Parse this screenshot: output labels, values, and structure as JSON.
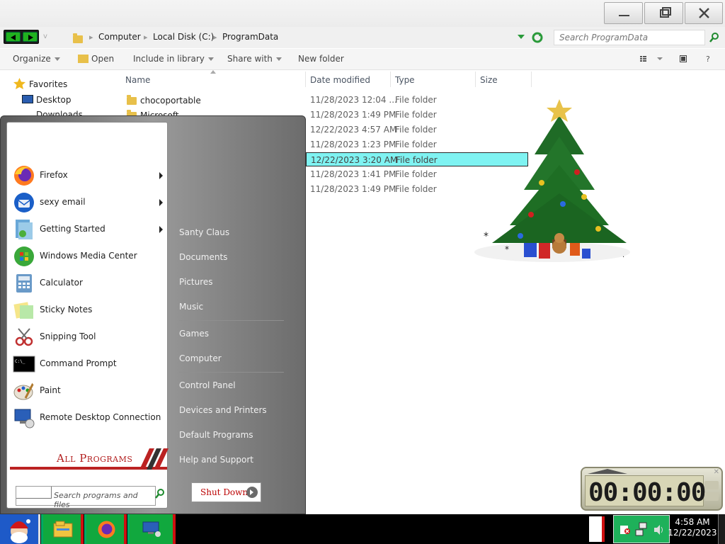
{
  "window": {
    "breadcrumb": [
      "Computer",
      "Local Disk (C:)",
      "ProgramData"
    ],
    "search_placeholder": "Search ProgramData"
  },
  "toolbar": {
    "organize": "Organize",
    "open": "Open",
    "include_in_library": "Include in library",
    "share_with": "Share with",
    "new_folder": "New folder"
  },
  "columns": {
    "name": "Name",
    "date_modified": "Date modified",
    "type": "Type",
    "size": "Size"
  },
  "nav_pane": {
    "favorites": "Favorites",
    "desktop": "Desktop",
    "downloads": "Downloads"
  },
  "files": [
    {
      "name": "chocoportable",
      "date": "11/28/2023 12:04 ...",
      "type": "File folder"
    },
    {
      "name": "Microsoft",
      "date": "11/28/2023 1:49 PM",
      "type": "File folder"
    },
    {
      "name": "",
      "date": "12/22/2023 4:57 AM",
      "type": "File folder"
    },
    {
      "name": "",
      "date": "11/28/2023 1:23 PM",
      "type": "File folder"
    },
    {
      "name": "",
      "date": "12/22/2023 3:20 AM",
      "type": "File folder",
      "selected": true
    },
    {
      "name": "",
      "date": "11/28/2023 1:41 PM",
      "type": "File folder"
    },
    {
      "name": "",
      "date": "11/28/2023 1:49 PM",
      "type": "File folder"
    }
  ],
  "start_menu": {
    "programs": [
      {
        "label": "Firefox",
        "icon": "firefox-icon",
        "submenu": true
      },
      {
        "label": "sexy email",
        "icon": "thunderbird-icon",
        "submenu": true
      },
      {
        "label": "Getting Started",
        "icon": "getting-started-icon",
        "submenu": true
      },
      {
        "label": "Windows Media Center",
        "icon": "media-center-icon",
        "submenu": false
      },
      {
        "label": "Calculator",
        "icon": "calculator-icon",
        "submenu": false
      },
      {
        "label": "Sticky Notes",
        "icon": "sticky-notes-icon",
        "submenu": false
      },
      {
        "label": "Snipping Tool",
        "icon": "snipping-tool-icon",
        "submenu": false
      },
      {
        "label": "Command Prompt",
        "icon": "command-prompt-icon",
        "submenu": false
      },
      {
        "label": "Paint",
        "icon": "paint-icon",
        "submenu": false
      },
      {
        "label": "Remote Desktop Connection",
        "icon": "remote-desktop-icon",
        "submenu": false
      }
    ],
    "all_programs": "All Programs",
    "search_placeholder": "Search programs and files",
    "places": [
      "Santy Claus",
      "Documents",
      "Pictures",
      "Music",
      "Games",
      "Computer",
      "Control Panel",
      "Devices and Printers",
      "Default Programs",
      "Help and Support"
    ],
    "shutdown": "Shut Down"
  },
  "timer": {
    "display": "00:00:00"
  },
  "clock": {
    "time": "4:58 AM",
    "date": "12/22/2023"
  }
}
